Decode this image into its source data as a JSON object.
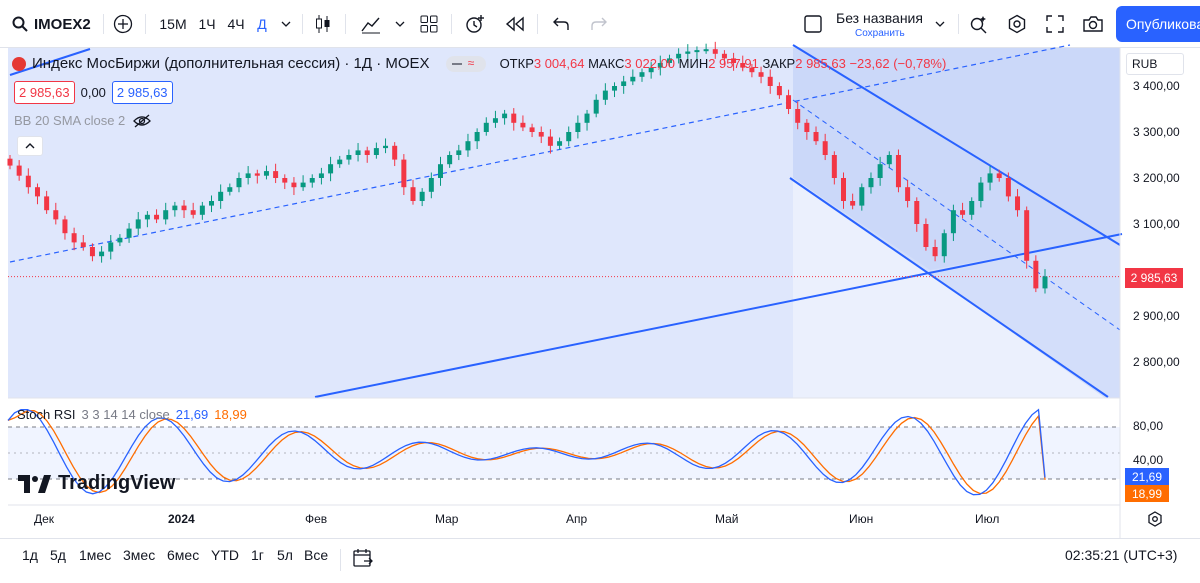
{
  "toolbar": {
    "symbol": "IMOEX2",
    "intervals": [
      "15M",
      "1Ч",
      "4Ч",
      "Д"
    ],
    "active_interval": "Д",
    "layout_name": "Без названия",
    "layout_save": "Сохранить",
    "publish_label": "Опубликовать"
  },
  "legend": {
    "title": "Индекс МосБиржи (дополнительная сессия) · 1Д · MOEX",
    "open_label": "ОТКР",
    "open": "3 004,64",
    "high_label": "МАКС",
    "high": "3 022,00",
    "low_label": "МИН",
    "low": "2 957,91",
    "close_label": "ЗАКР",
    "close": "2 985,63",
    "change": "−23,62 (−0,78%)",
    "bid": "2 985,63",
    "spread": "0,00",
    "ask": "2 985,63",
    "indicator": "BB 20 SMA close 2"
  },
  "price_axis": {
    "currency": "RUB",
    "labels": [
      "3 400,00",
      "3 300,00",
      "3 200,00",
      "3 100,00",
      "2 900,00",
      "2 800,00"
    ],
    "current_price": "2 985,63"
  },
  "stoch": {
    "label": "Stoch RSI",
    "params": "3 3 14 14 close",
    "k_value": "21,69",
    "d_value": "18,99",
    "levels": [
      "80,00",
      "40,00"
    ],
    "k_color": "#2962ff",
    "d_color": "#ff6d00"
  },
  "time_axis": [
    "Дек",
    "2024",
    "Фев",
    "Мар",
    "Апр",
    "Май",
    "Июн",
    "Июл"
  ],
  "watermark": "TradingView",
  "ranges": [
    "1д",
    "5д",
    "1мес",
    "3мес",
    "6мес",
    "YTD",
    "1г",
    "5л",
    "Все"
  ],
  "clock": "02:35:21 (UTC+3)",
  "colors": {
    "up": "#089981",
    "down": "#f23645",
    "accent": "#2962ff",
    "channel_fill": "#dbe4fb"
  },
  "chart_data": {
    "type": "candlestick",
    "series": [
      {
        "name": "IMOEX2",
        "close": [
          3227,
          3205,
          3180,
          3160,
          3130,
          3110,
          3080,
          3060,
          3050,
          3030,
          3040,
          3060,
          3070,
          3090,
          3110,
          3120,
          3110,
          3130,
          3140,
          3130,
          3120,
          3140,
          3150,
          3170,
          3180,
          3200,
          3210,
          3205,
          3215,
          3200,
          3190,
          3180,
          3190,
          3200,
          3210,
          3230,
          3240,
          3250,
          3260,
          3250,
          3265,
          3270,
          3240,
          3180,
          3150,
          3170,
          3200,
          3230,
          3250,
          3260,
          3280,
          3300,
          3320,
          3330,
          3340,
          3320,
          3310,
          3300,
          3290,
          3270,
          3280,
          3300,
          3320,
          3340,
          3370,
          3390,
          3400,
          3410,
          3420,
          3430,
          3440,
          3450,
          3460,
          3470,
          3475,
          3478,
          3480,
          3470,
          3460,
          3450,
          3440,
          3430,
          3420,
          3400,
          3380,
          3350,
          3320,
          3300,
          3280,
          3250,
          3200,
          3150,
          3140,
          3180,
          3200,
          3230,
          3250,
          3180,
          3150,
          3100,
          3050,
          3030,
          3080,
          3130,
          3120,
          3150,
          3190,
          3210,
          3200,
          3160,
          3130,
          3020,
          2960,
          2986
        ]
      }
    ],
    "ylim": [
      2760,
      3480
    ],
    "channel_lines": "descending channel and ascending trend channel drawn",
    "stoch_rsi": {
      "k_last": 21.69,
      "d_last": 18.99,
      "upper_band": 80,
      "lower_band": 20
    }
  }
}
